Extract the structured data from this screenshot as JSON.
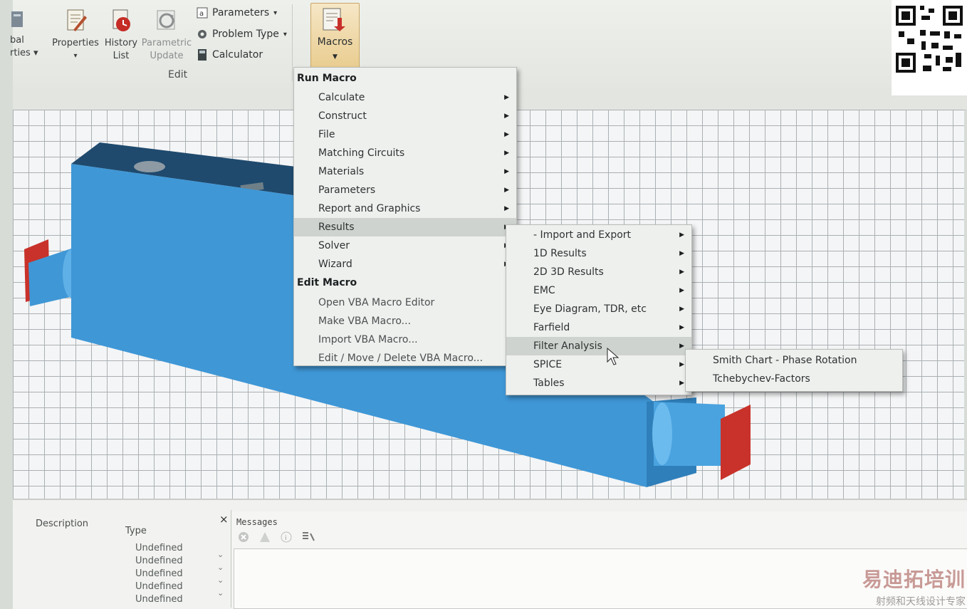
{
  "ribbon": {
    "left_partial_label_1": "bal",
    "left_partial_label_2": "rties",
    "properties_label": "Properties",
    "history_label_1": "History",
    "history_label_2": "List",
    "parametric_label_1": "Parametric",
    "parametric_label_2": "Update",
    "parameters_label": "Parameters",
    "problem_type_label": "Problem Type",
    "calculator_label": "Calculator",
    "group_edit_label": "Edit",
    "macros_label": "Macros"
  },
  "menu": {
    "run_macro_header": "Run Macro",
    "run_items": [
      {
        "label": "Calculate"
      },
      {
        "label": "Construct"
      },
      {
        "label": "File"
      },
      {
        "label": "Matching Circuits"
      },
      {
        "label": "Materials"
      },
      {
        "label": "Parameters"
      },
      {
        "label": "Report and Graphics"
      },
      {
        "label": "Results"
      },
      {
        "label": "Solver"
      },
      {
        "label": "Wizard"
      }
    ],
    "edit_macro_header": "Edit Macro",
    "edit_items": [
      {
        "label": "Open VBA Macro Editor"
      },
      {
        "label": "Make VBA Macro..."
      },
      {
        "label": "Import VBA Macro..."
      },
      {
        "label": "Edit / Move / Delete VBA Macro..."
      }
    ]
  },
  "results_submenu": [
    {
      "label": "- Import and Export"
    },
    {
      "label": "1D Results"
    },
    {
      "label": "2D 3D Results"
    },
    {
      "label": "EMC"
    },
    {
      "label": "Eye Diagram, TDR, etc"
    },
    {
      "label": "Farfield"
    },
    {
      "label": "Filter Analysis"
    },
    {
      "label": "SPICE"
    },
    {
      "label": "Tables"
    }
  ],
  "filter_submenu": [
    {
      "label": "Smith Chart - Phase Rotation"
    },
    {
      "label": "Tchebychev-Factors"
    }
  ],
  "params_panel": {
    "description_header": "Description",
    "type_header": "Type",
    "close_symbol": "×",
    "rows": [
      "Undefined",
      "Undefined",
      "Undefined",
      "Undefined",
      "Undefined"
    ]
  },
  "messages_panel": {
    "title": "Messages"
  },
  "watermark": {
    "title": "易迪拓培训",
    "subtitle": "射频和天线设计专家"
  },
  "colors": {
    "model_blue": "#3f97d6",
    "port_red": "#c8322a",
    "menu_bg": "#eef0ee",
    "macros_highlight": "#e9cc8f"
  }
}
